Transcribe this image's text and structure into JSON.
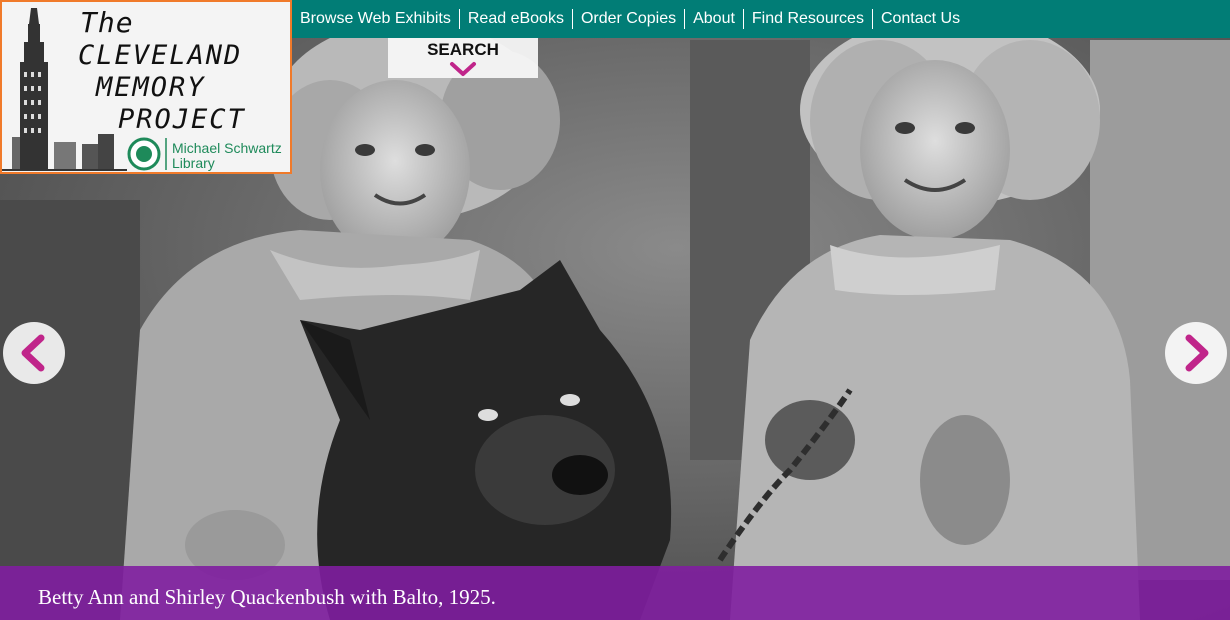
{
  "logo": {
    "line1": "The",
    "line2": "CLEVELAND",
    "line3": "MEMORY",
    "line4": "PROJECT",
    "library_line1": "Michael Schwartz",
    "library_line2": "Library",
    "seal_icon": "cleveland-state-university-seal"
  },
  "nav": {
    "items": [
      {
        "label": "Browse Web Exhibits"
      },
      {
        "label": "Read eBooks"
      },
      {
        "label": "Order Copies"
      },
      {
        "label": "About"
      },
      {
        "label": "Find Resources"
      },
      {
        "label": "Contact Us"
      }
    ]
  },
  "search": {
    "label": "SEARCH",
    "icon": "chevron-down-icon"
  },
  "slider": {
    "prev_icon": "chevron-left-icon",
    "next_icon": "chevron-right-icon",
    "caption": "Betty Ann and Shirley Quackenbush with Balto, 1925."
  },
  "colors": {
    "nav_bg": "#017d76",
    "logo_border": "#f07a2a",
    "accent": "#c0258a",
    "caption_bg": "#801ea0"
  }
}
